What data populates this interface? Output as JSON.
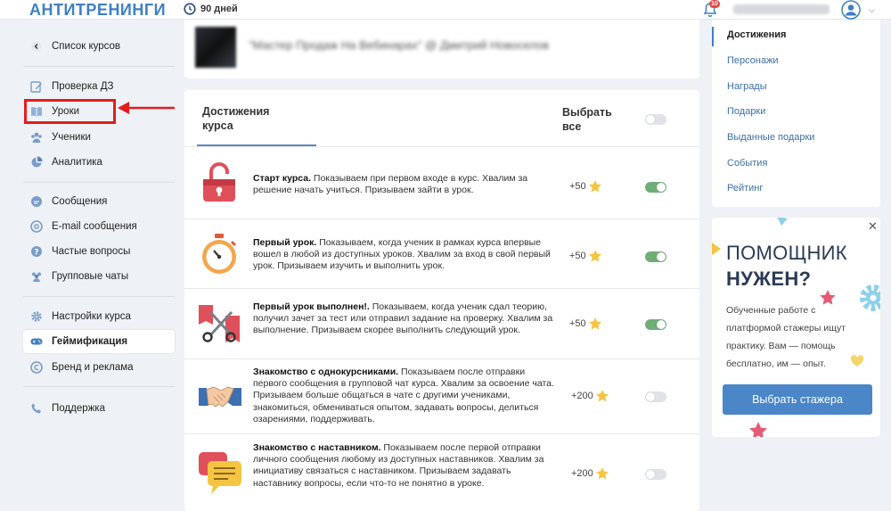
{
  "header": {
    "logo": "АНТИТРЕНИНГИ",
    "days": "90 дней",
    "notif_count": "10"
  },
  "sidebar": {
    "back_label": "Список курсов",
    "items": [
      {
        "label": "Проверка ДЗ",
        "icon": "edit-icon"
      },
      {
        "label": "Уроки",
        "icon": "book-icon"
      },
      {
        "label": "Ученики",
        "icon": "users-icon"
      },
      {
        "label": "Аналитика",
        "icon": "pie-chart-icon"
      },
      {
        "label": "Сообщения",
        "icon": "chat-icon"
      },
      {
        "label": "E-mail сообщения",
        "icon": "at-icon"
      },
      {
        "label": "Частые вопросы",
        "icon": "question-icon"
      },
      {
        "label": "Групповые чаты",
        "icon": "group-icon"
      },
      {
        "label": "Настройки курса",
        "icon": "gear-icon"
      },
      {
        "label": "Геймификация",
        "icon": "gamepad-icon"
      },
      {
        "label": "Бренд и реклама",
        "icon": "copyright-icon"
      },
      {
        "label": "Поддержка",
        "icon": "phone-icon"
      }
    ]
  },
  "top_card": {
    "title": "\"Мастер Продаж На Вебинарах\" @ Дмитрий Новоселов"
  },
  "main": {
    "tab_label": "Достижения курса",
    "select_all_label": "Выбрать все",
    "achievements": [
      {
        "title": "Старт курса.",
        "desc": " Показываем при первом входе в курс. Хвалим за решение начать учиться. Призываем зайти в урок.",
        "points": "+50",
        "enabled": true,
        "icon": "unlocked-padlock-icon"
      },
      {
        "title": "Первый урок.",
        "desc": " Показываем, когда ученик в рамках курса впервые вошел в любой из доступных уроков. Хвалим за вход в свой первый урок. Призываем изучить и выполнить урок.",
        "points": "+50",
        "enabled": true,
        "icon": "stopwatch-icon"
      },
      {
        "title": "Первый урок выполнен!.",
        "desc": " Показываем, когда ученик сдал теорию, получил зачет за тест или отправил задание на проверку. Хвалим за выполнение. Призываем скорее выполнить следующий урок.",
        "points": "+50",
        "enabled": true,
        "icon": "ribbon-scissors-icon"
      },
      {
        "title": "Знакомство с однокурсниками.",
        "desc": " Показываем после отправки первого сообщения в групповой чат курса. Хвалим за освоение чата. Призываем больше общаться в чате с другими учениками, знакомиться, обмениваться опытом, задавать вопросы, делиться озарениями, поддерживать.",
        "points": "+200",
        "enabled": false,
        "icon": "handshake-icon"
      },
      {
        "title": "Знакомство с наставником.",
        "desc": " Показываем после первой отправки личного сообщения любому из доступных наставников. Хвалим за инициативу связаться с наставником. Призываем задавать наставнику вопросы, если что-то не понятно в уроке.",
        "points": "+200",
        "enabled": false,
        "icon": "speech-bubbles-icon"
      }
    ]
  },
  "right_nav": {
    "items": [
      "Достижения",
      "Персонажи",
      "Награды",
      "Подарки",
      "Выданные подарки",
      "События",
      "Рейтинг"
    ]
  },
  "promo": {
    "title_line1": "ПОМОЩНИК",
    "title_line2": "НУЖЕН?",
    "text": "Обученные работе с платформой стажеры ищут практику. Вам — помощь бесплатно, им — опыт.",
    "button": "Выбрать стажера"
  },
  "colors": {
    "accent": "#3f7fc5",
    "highlight": "#e31d1d",
    "toggle_on": "#6fae77",
    "button": "#4a86c8"
  }
}
